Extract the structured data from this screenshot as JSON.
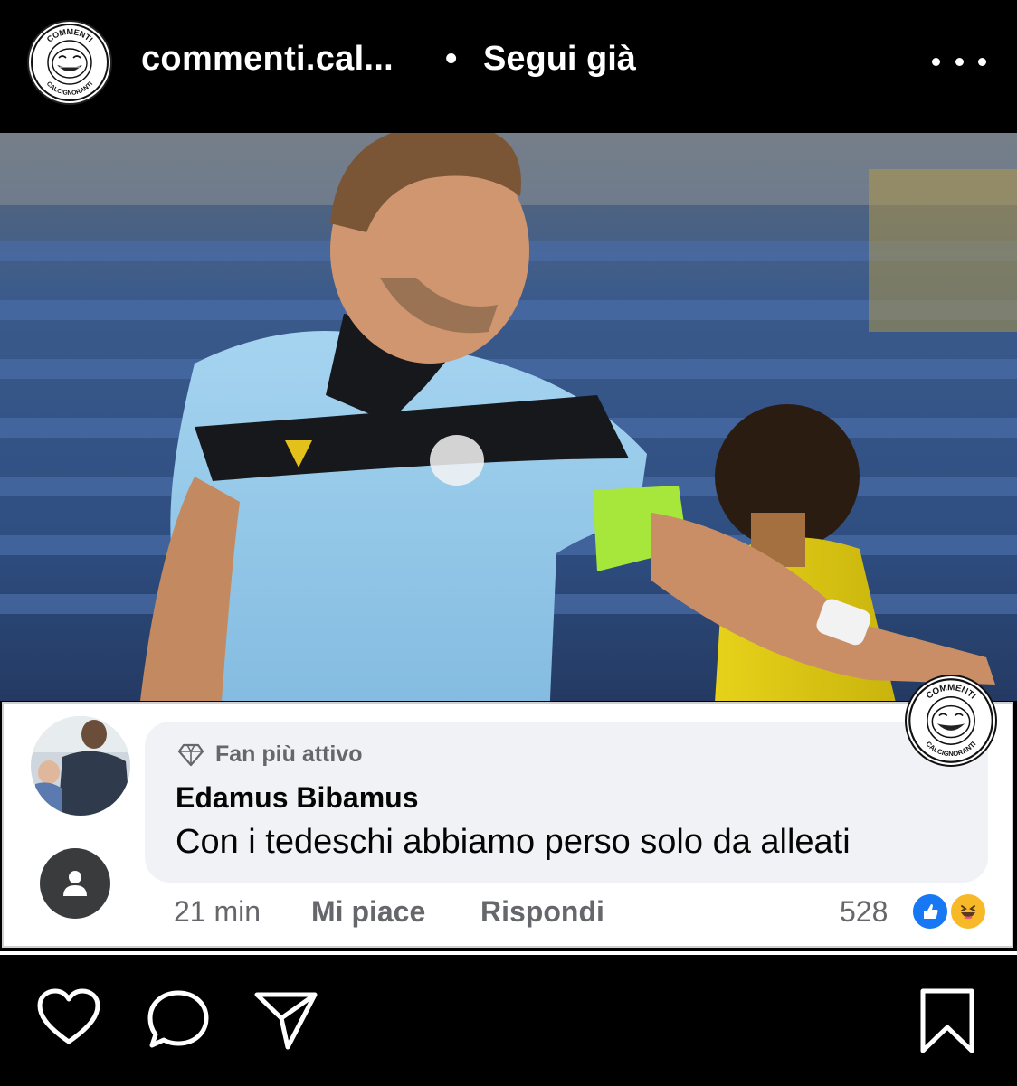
{
  "header": {
    "username": "commenti.cal...",
    "separator": "•",
    "follow_label": "Segui già",
    "more_icon": "more-horizontal-icon"
  },
  "logo": {
    "top_text": "COMMENTI",
    "bottom_text": "CALCIGNORANTI"
  },
  "comment": {
    "badge_icon": "diamond-icon",
    "badge_label": "Fan più attivo",
    "author": "Edamus Bibamus",
    "text": "Con i tedeschi abbiamo perso solo da alleati",
    "time": "21 min",
    "like_label": "Mi piace",
    "reply_label": "Rispondi",
    "reaction_count": "528",
    "reactions": [
      "like-reaction-icon",
      "haha-reaction-icon"
    ]
  },
  "actions": {
    "icons": [
      "heart-icon",
      "comment-icon",
      "share-icon",
      "bookmark-icon"
    ]
  },
  "colors": {
    "background": "#000000",
    "facebook_blue": "#1877f2",
    "bubble": "#f0f2f5",
    "jersey": "#8fc6e8"
  }
}
